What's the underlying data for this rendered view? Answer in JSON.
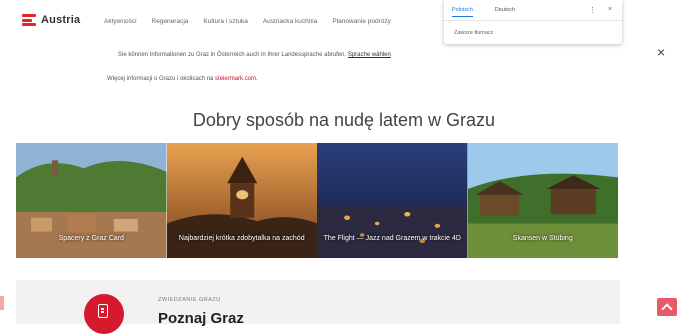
{
  "brand": {
    "name": "Austria"
  },
  "nav": {
    "items": [
      "Aktywności",
      "Regeneracja",
      "Kultura i sztuka",
      "Austriacka kuchnia",
      "Planowanie podróży"
    ]
  },
  "translate_popup": {
    "tab_active": "Polnisch",
    "tab_other": "Deutsch",
    "more": "⋮",
    "close": "×",
    "option": "Zawsze tłumacz"
  },
  "info": {
    "line1": "Sie können Informationen zu Graz in Österreich auch in Ihrer Landessprache abrufen.",
    "line1_link": "Sprache wählen",
    "line2": "Więcej informacji o Grazu i okolicach na",
    "line2_link": "steiermark.com."
  },
  "banner_close": "×",
  "heading": "Dobry sposób na nudę latem w Grazu",
  "tiles": [
    {
      "caption": "Spacery z Graz Card",
      "colors": [
        "#7fa6c9",
        "#5d7a3a",
        "#a87b4d"
      ]
    },
    {
      "caption": "Najbardziej krótka zdobytalka na zachód",
      "colors": [
        "#d8893a",
        "#b4602a",
        "#4a2a1a"
      ]
    },
    {
      "caption": "The Flight — Jazz nad Grazem w trakcie 4D",
      "colors": [
        "#2a3f7a",
        "#1d2a55",
        "#c7853a"
      ]
    },
    {
      "caption": "Skansen w Stübing",
      "colors": [
        "#8fc3ea",
        "#4f7d33",
        "#6b4a2a"
      ]
    }
  ],
  "bottom": {
    "eyebrow": "ZWIEDZANIE GRAZU",
    "title": "Poznaj Graz"
  },
  "icons": {
    "logo": "austria-flag-icon",
    "section": "document-icon",
    "scroll": "chevron-up-icon"
  }
}
